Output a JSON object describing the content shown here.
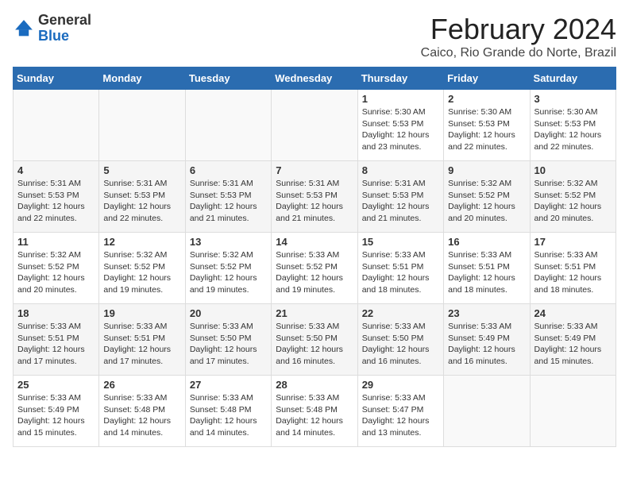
{
  "header": {
    "logo_general": "General",
    "logo_blue": "Blue",
    "month_title": "February 2024",
    "location": "Caico, Rio Grande do Norte, Brazil"
  },
  "weekdays": [
    "Sunday",
    "Monday",
    "Tuesday",
    "Wednesday",
    "Thursday",
    "Friday",
    "Saturday"
  ],
  "weeks": [
    [
      {
        "day": "",
        "info": ""
      },
      {
        "day": "",
        "info": ""
      },
      {
        "day": "",
        "info": ""
      },
      {
        "day": "",
        "info": ""
      },
      {
        "day": "1",
        "info": "Sunrise: 5:30 AM\nSunset: 5:53 PM\nDaylight: 12 hours\nand 23 minutes."
      },
      {
        "day": "2",
        "info": "Sunrise: 5:30 AM\nSunset: 5:53 PM\nDaylight: 12 hours\nand 22 minutes."
      },
      {
        "day": "3",
        "info": "Sunrise: 5:30 AM\nSunset: 5:53 PM\nDaylight: 12 hours\nand 22 minutes."
      }
    ],
    [
      {
        "day": "4",
        "info": "Sunrise: 5:31 AM\nSunset: 5:53 PM\nDaylight: 12 hours\nand 22 minutes."
      },
      {
        "day": "5",
        "info": "Sunrise: 5:31 AM\nSunset: 5:53 PM\nDaylight: 12 hours\nand 22 minutes."
      },
      {
        "day": "6",
        "info": "Sunrise: 5:31 AM\nSunset: 5:53 PM\nDaylight: 12 hours\nand 21 minutes."
      },
      {
        "day": "7",
        "info": "Sunrise: 5:31 AM\nSunset: 5:53 PM\nDaylight: 12 hours\nand 21 minutes."
      },
      {
        "day": "8",
        "info": "Sunrise: 5:31 AM\nSunset: 5:53 PM\nDaylight: 12 hours\nand 21 minutes."
      },
      {
        "day": "9",
        "info": "Sunrise: 5:32 AM\nSunset: 5:52 PM\nDaylight: 12 hours\nand 20 minutes."
      },
      {
        "day": "10",
        "info": "Sunrise: 5:32 AM\nSunset: 5:52 PM\nDaylight: 12 hours\nand 20 minutes."
      }
    ],
    [
      {
        "day": "11",
        "info": "Sunrise: 5:32 AM\nSunset: 5:52 PM\nDaylight: 12 hours\nand 20 minutes."
      },
      {
        "day": "12",
        "info": "Sunrise: 5:32 AM\nSunset: 5:52 PM\nDaylight: 12 hours\nand 19 minutes."
      },
      {
        "day": "13",
        "info": "Sunrise: 5:32 AM\nSunset: 5:52 PM\nDaylight: 12 hours\nand 19 minutes."
      },
      {
        "day": "14",
        "info": "Sunrise: 5:33 AM\nSunset: 5:52 PM\nDaylight: 12 hours\nand 19 minutes."
      },
      {
        "day": "15",
        "info": "Sunrise: 5:33 AM\nSunset: 5:51 PM\nDaylight: 12 hours\nand 18 minutes."
      },
      {
        "day": "16",
        "info": "Sunrise: 5:33 AM\nSunset: 5:51 PM\nDaylight: 12 hours\nand 18 minutes."
      },
      {
        "day": "17",
        "info": "Sunrise: 5:33 AM\nSunset: 5:51 PM\nDaylight: 12 hours\nand 18 minutes."
      }
    ],
    [
      {
        "day": "18",
        "info": "Sunrise: 5:33 AM\nSunset: 5:51 PM\nDaylight: 12 hours\nand 17 minutes."
      },
      {
        "day": "19",
        "info": "Sunrise: 5:33 AM\nSunset: 5:51 PM\nDaylight: 12 hours\nand 17 minutes."
      },
      {
        "day": "20",
        "info": "Sunrise: 5:33 AM\nSunset: 5:50 PM\nDaylight: 12 hours\nand 17 minutes."
      },
      {
        "day": "21",
        "info": "Sunrise: 5:33 AM\nSunset: 5:50 PM\nDaylight: 12 hours\nand 16 minutes."
      },
      {
        "day": "22",
        "info": "Sunrise: 5:33 AM\nSunset: 5:50 PM\nDaylight: 12 hours\nand 16 minutes."
      },
      {
        "day": "23",
        "info": "Sunrise: 5:33 AM\nSunset: 5:49 PM\nDaylight: 12 hours\nand 16 minutes."
      },
      {
        "day": "24",
        "info": "Sunrise: 5:33 AM\nSunset: 5:49 PM\nDaylight: 12 hours\nand 15 minutes."
      }
    ],
    [
      {
        "day": "25",
        "info": "Sunrise: 5:33 AM\nSunset: 5:49 PM\nDaylight: 12 hours\nand 15 minutes."
      },
      {
        "day": "26",
        "info": "Sunrise: 5:33 AM\nSunset: 5:48 PM\nDaylight: 12 hours\nand 14 minutes."
      },
      {
        "day": "27",
        "info": "Sunrise: 5:33 AM\nSunset: 5:48 PM\nDaylight: 12 hours\nand 14 minutes."
      },
      {
        "day": "28",
        "info": "Sunrise: 5:33 AM\nSunset: 5:48 PM\nDaylight: 12 hours\nand 14 minutes."
      },
      {
        "day": "29",
        "info": "Sunrise: 5:33 AM\nSunset: 5:47 PM\nDaylight: 12 hours\nand 13 minutes."
      },
      {
        "day": "",
        "info": ""
      },
      {
        "day": "",
        "info": ""
      }
    ]
  ]
}
